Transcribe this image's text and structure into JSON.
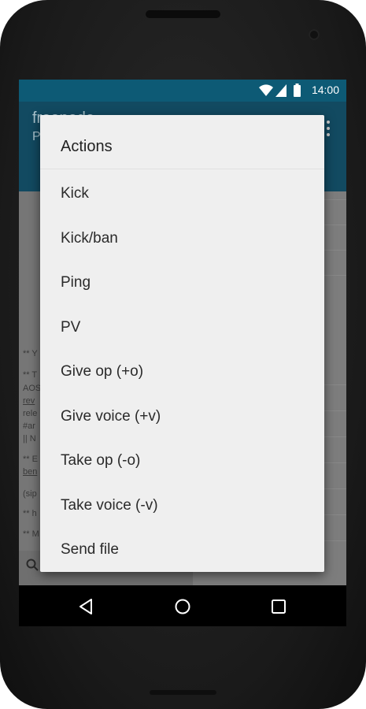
{
  "status_bar": {
    "time": "14:00"
  },
  "app_bar": {
    "title": "freenode",
    "subtitle": "P"
  },
  "chat_fragments": [
    "** Y",
    "** T",
    "AOS",
    "rev",
    "rele",
    "#ar",
    "|| N",
    "** E",
    "ben",
    "(sip",
    "** h",
    "** M"
  ],
  "dialog": {
    "title": "Actions",
    "items": [
      "Kick",
      "Kick/ban",
      "Ping",
      "PV",
      "Give op (+o)",
      "Give voice (+v)",
      "Take op (-o)",
      "Take voice (-v)",
      "Send file"
    ]
  },
  "colors": {
    "status_bar": "#0d5a75",
    "app_bar": "#124a61",
    "dialog_bg": "#efefef",
    "nav_bar": "#000000"
  },
  "icons": {
    "wifi": "wifi-icon",
    "signal": "signal-icon",
    "battery": "battery-icon",
    "back": "back-icon",
    "home": "home-icon",
    "recents": "recents-icon",
    "search": "search-icon"
  }
}
